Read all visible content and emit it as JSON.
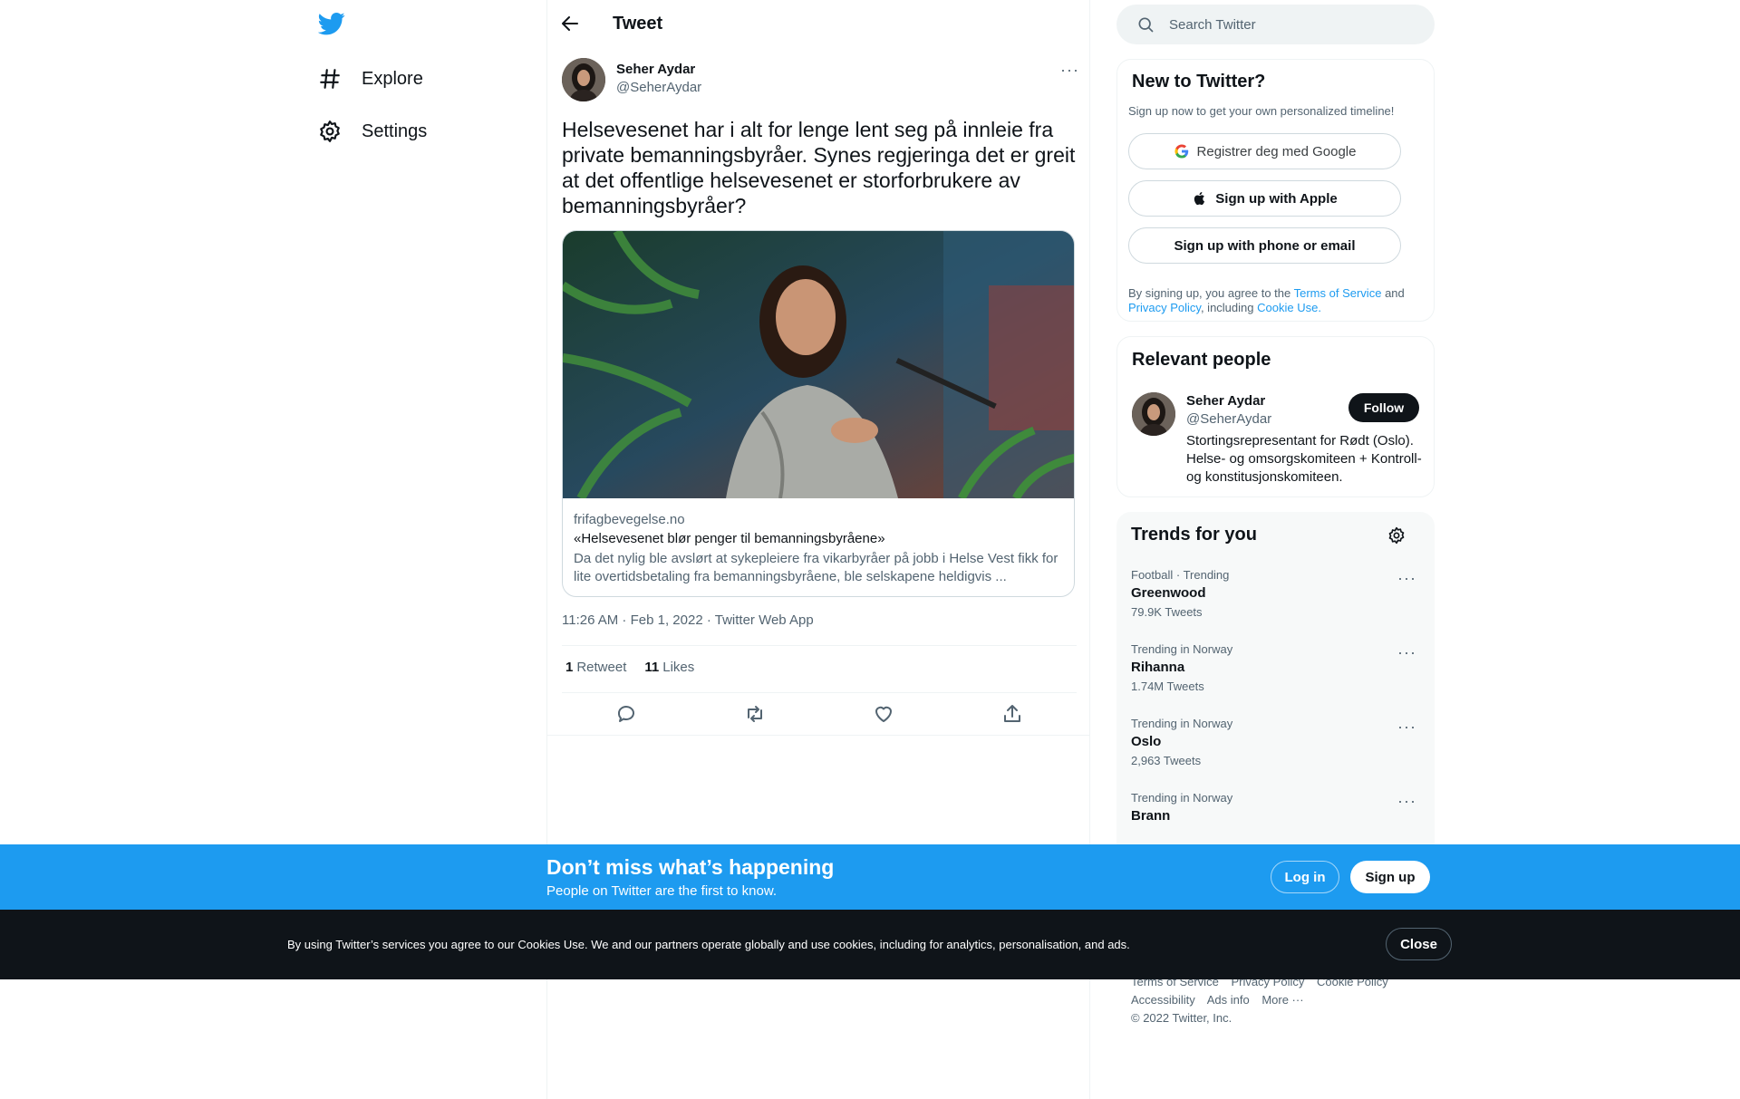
{
  "nav": {
    "explore_label": "Explore",
    "settings_label": "Settings"
  },
  "header": {
    "title": "Tweet"
  },
  "tweet": {
    "author_name": "Seher Aydar",
    "author_handle": "@SeherAydar",
    "text": "Helsevesenet har i alt for lenge lent seg på innleie fra private bemanningsbyråer. Synes regjeringa det er greit at det offentlige helsevesenet er storforbrukere av bemanningsbyråer?",
    "card": {
      "domain": "frifagbevegelse.no",
      "title": "«Helsevesenet blør penger til bemanningsbyråene»",
      "description": "Da det nylig ble avslørt at sykepleiere fra vikarbyråer på jobb i Helse Vest fikk for lite overtidsbetaling fra bemanningsbyråene, ble selskapene heldigvis ..."
    },
    "time": "11:26 AM",
    "date": "Feb 1, 2022",
    "source": "Twitter Web App",
    "retweet_count": "1",
    "retweet_label": "Retweet",
    "like_count": "11",
    "like_label": "Likes"
  },
  "search": {
    "placeholder": "Search Twitter"
  },
  "signup_panel": {
    "title": "New to Twitter?",
    "subtitle": "Sign up now to get your own personalized timeline!",
    "google_label": "Registrer deg med Google",
    "apple_label": "Sign up with Apple",
    "phone_label": "Sign up with phone or email",
    "terms_prefix": "By signing up, you agree to the",
    "terms_link": "Terms of Service",
    "terms_and": "and",
    "privacy_link": "Privacy Policy",
    "including": ", including",
    "cookie_link": "Cookie Use."
  },
  "relevant_people": {
    "title": "Relevant people",
    "name": "Seher Aydar",
    "handle": "@SeherAydar",
    "follow_label": "Follow",
    "bio": "Stortingsrepresentant for Rødt (Oslo). Helse- og omsorgskomiteen + Kontroll- og konstitusjonskomiteen."
  },
  "trends": {
    "title": "Trends for you",
    "items": [
      {
        "context": "Football · Trending",
        "name": "Greenwood",
        "count": "79.9K Tweets"
      },
      {
        "context": "Trending in Norway",
        "name": "Rihanna",
        "count": "1.74M Tweets"
      },
      {
        "context": "Trending in Norway",
        "name": "Oslo",
        "count": "2,963 Tweets"
      },
      {
        "context": "Trending in Norway",
        "name": "Brann",
        "count": ""
      }
    ]
  },
  "footer": {
    "links_row1": [
      "Terms of Service",
      "Privacy Policy",
      "Cookie Policy"
    ],
    "links_row2": [
      "Accessibility",
      "Ads info",
      "More ···"
    ],
    "copyright": "© 2022 Twitter, Inc."
  },
  "bottom_bar": {
    "title": "Don’t miss what’s happening",
    "subtitle": "People on Twitter are the first to know.",
    "login_label": "Log in",
    "signup_label": "Sign up"
  },
  "cookie_bar": {
    "text": "By using Twitter’s services you agree to our Cookies Use. We and our partners operate globally and use cookies, including for analytics, personalisation, and ads.",
    "close_label": "Close"
  },
  "colors": {
    "brand": "#1d9bf0",
    "text": "#0f1419",
    "secondary": "#536471",
    "cookie_bg": "#0f1419"
  },
  "icons": [
    "twitter-logo-icon",
    "hashtag-icon",
    "gear-icon",
    "back-arrow-icon",
    "search-icon",
    "google-icon",
    "apple-icon",
    "reply-icon",
    "retweet-icon",
    "like-icon",
    "share-icon",
    "more-icon"
  ]
}
